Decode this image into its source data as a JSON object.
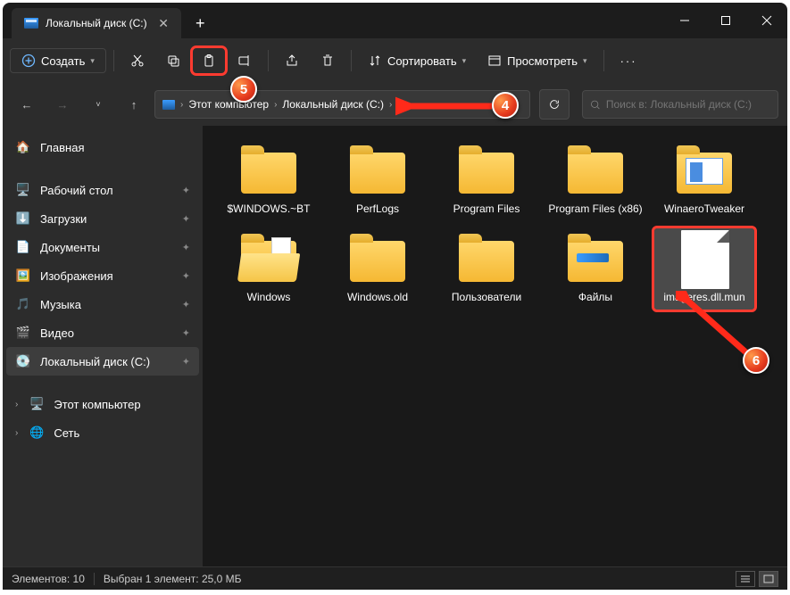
{
  "tab": {
    "title": "Локальный диск (C:)"
  },
  "toolbar": {
    "create": "Создать",
    "sort": "Сортировать",
    "view": "Просмотреть"
  },
  "breadcrumb": {
    "root_icon": "disk",
    "segments": [
      "Этот компьютер",
      "Локальный диск (C:)"
    ]
  },
  "search": {
    "placeholder": "Поиск в: Локальный диск (C:)"
  },
  "sidebar": {
    "home": "Главная",
    "quick": [
      {
        "label": "Рабочий стол",
        "icon": "desktop"
      },
      {
        "label": "Загрузки",
        "icon": "downloads"
      },
      {
        "label": "Документы",
        "icon": "documents"
      },
      {
        "label": "Изображения",
        "icon": "pictures"
      },
      {
        "label": "Музыка",
        "icon": "music"
      },
      {
        "label": "Видео",
        "icon": "video"
      },
      {
        "label": "Локальный диск (C:)",
        "icon": "disk",
        "active": true
      }
    ],
    "drives": [
      {
        "label": "Этот компьютер",
        "icon": "pc",
        "expandable": true
      },
      {
        "label": "Сеть",
        "icon": "network",
        "expandable": true
      }
    ]
  },
  "items": [
    {
      "name": "$WINDOWS.~BT",
      "type": "folder"
    },
    {
      "name": "PerfLogs",
      "type": "folder"
    },
    {
      "name": "Program Files",
      "type": "folder"
    },
    {
      "name": "Program Files (x86)",
      "type": "folder"
    },
    {
      "name": "WinaeroTweaker",
      "type": "folder-tweaker"
    },
    {
      "name": "Windows",
      "type": "folder-open"
    },
    {
      "name": "Windows.old",
      "type": "folder"
    },
    {
      "name": "Пользователи",
      "type": "folder"
    },
    {
      "name": "Файлы",
      "type": "folder-blue"
    },
    {
      "name": "imageres.dll.mun",
      "type": "file",
      "selected": true
    }
  ],
  "status": {
    "count_label": "Элементов: 10",
    "selection_label": "Выбран 1 элемент: 25,0 МБ"
  },
  "annotations": {
    "b4": "4",
    "b5": "5",
    "b6": "6"
  }
}
